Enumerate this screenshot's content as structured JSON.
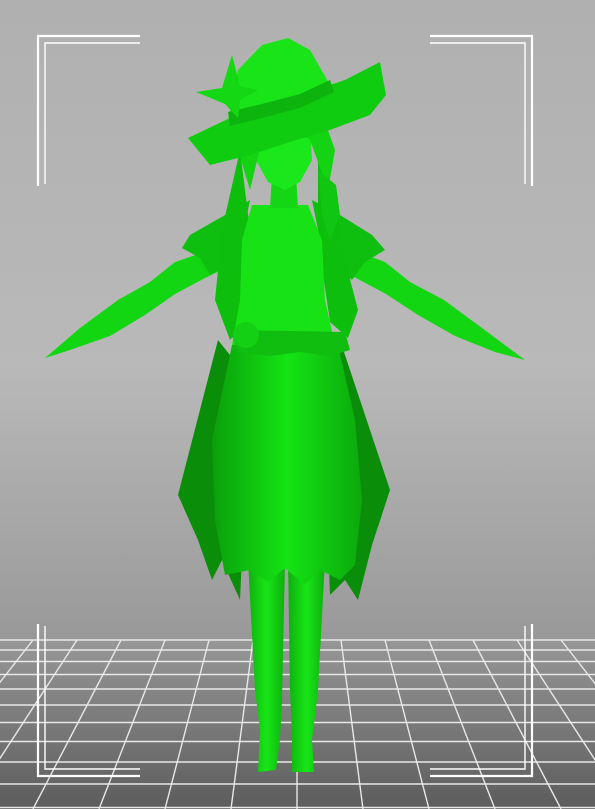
{
  "viewport": {
    "description_label": "",
    "background_top_color": "#b0b0b0",
    "background_bottom_color": "#5c5c5c",
    "grid_line_color": "#e8e8e8",
    "frame_bracket_color": "#ffffff"
  },
  "model": {
    "name": "",
    "fill_color": "#11e011",
    "shadow_color": "#0a9c0a",
    "highlight_color": "#39f539"
  }
}
